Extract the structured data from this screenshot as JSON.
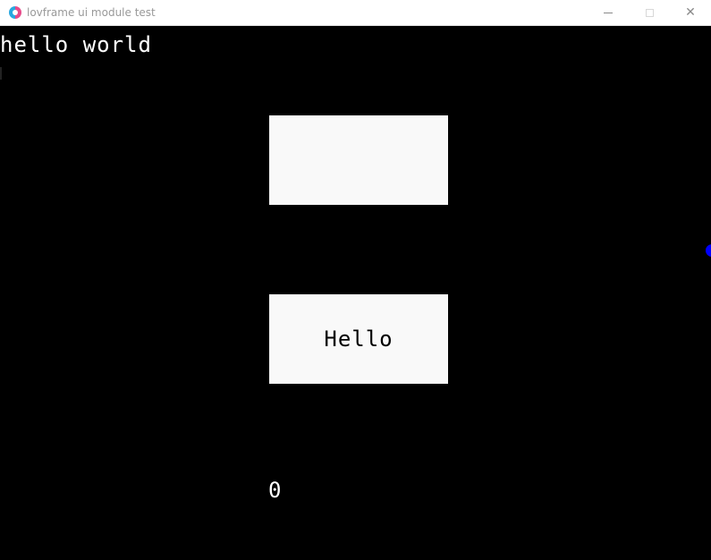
{
  "window": {
    "title": "lovframe ui module test",
    "minimize_icon": "minimize-icon",
    "maximize_icon": "maximize-icon",
    "close_icon": "close-icon",
    "close_glyph": "✕"
  },
  "canvas": {
    "heading": "hello world",
    "hello_button_label": "Hello",
    "counter_value": "0"
  },
  "colors": {
    "background": "#000000",
    "box": "#f9f9f9",
    "text": "#ffffff",
    "dot": "#0000ff"
  }
}
